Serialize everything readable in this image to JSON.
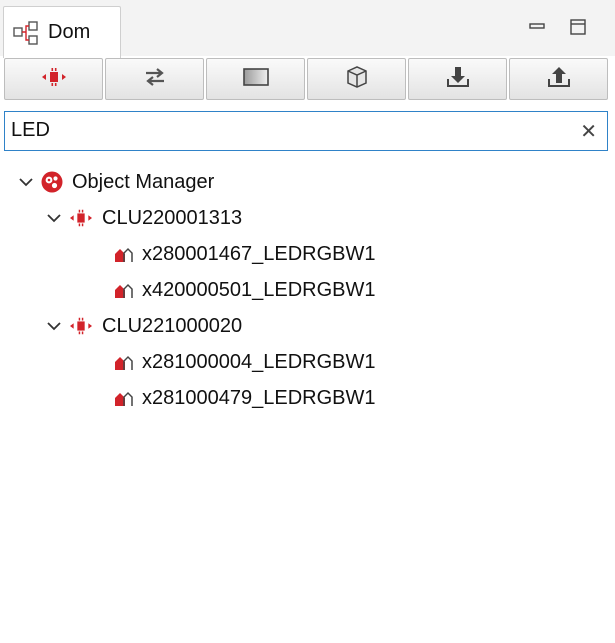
{
  "tab": {
    "title": "Dom",
    "icon": "dom-tree-icon"
  },
  "window_controls": {
    "minimize_icon": "minimize-icon",
    "maximize_icon": "maximize-icon"
  },
  "toolbar": {
    "buttons": [
      {
        "icon": "clu-module-icon"
      },
      {
        "icon": "sync-arrows-icon"
      },
      {
        "icon": "panel-icon"
      },
      {
        "icon": "box-icon"
      },
      {
        "icon": "import-down-icon"
      },
      {
        "icon": "export-up-icon"
      }
    ]
  },
  "search": {
    "value": "LED",
    "clear_icon": "close-icon",
    "clear_glyph": "✕"
  },
  "tree": {
    "root": {
      "label": "Object Manager",
      "icon": "object-manager-icon"
    },
    "groups": [
      {
        "label": "CLU220001313",
        "children": [
          {
            "label": "x280001467_LEDRGBW1"
          },
          {
            "label": "x420000501_LEDRGBW1"
          }
        ]
      },
      {
        "label": "CLU221000020",
        "children": [
          {
            "label": "x281000004_LEDRGBW1"
          },
          {
            "label": "x281000479_LEDRGBW1"
          }
        ]
      }
    ]
  },
  "colors": {
    "accent_red": "#d2232a",
    "focus_blue": "#2f82c8"
  }
}
